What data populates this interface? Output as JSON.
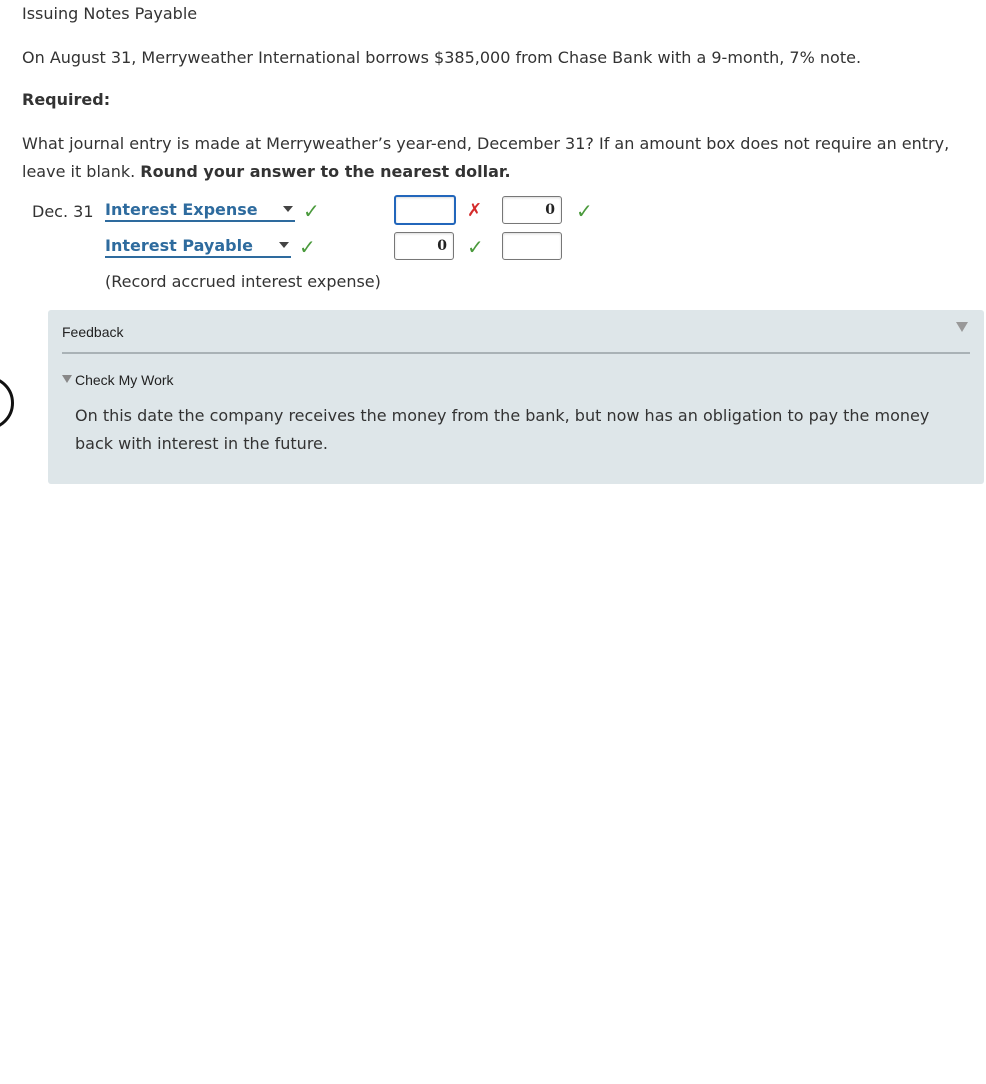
{
  "header": {
    "title": "Issuing Notes Payable"
  },
  "problem": {
    "intro": "On August 31, Merryweather International borrows $385,000 from Chase Bank with a 9-month, 7% note.",
    "required_label": "Required:",
    "question_text": "What journal entry is made at Merryweather’s year-end, December 31? If an amount box does not require an entry, leave it blank.",
    "question_bold": "Round your answer to the nearest dollar."
  },
  "journal": {
    "date": "Dec. 31",
    "rows": [
      {
        "account": "Interest Expense",
        "debit": "",
        "credit": "0",
        "account_status": "correct",
        "debit_status": "incorrect",
        "credit_status": "correct"
      },
      {
        "account": "Interest Payable",
        "debit": "0",
        "credit": "",
        "account_status": "correct",
        "debit_status": "correct"
      }
    ],
    "memo": "(Record accrued interest expense)"
  },
  "feedback": {
    "title": "Feedback",
    "check_my_work": "Check My Work",
    "text": "On this date the company receives the money from the bank, but now has an obligation to pay the money back with interest in the future."
  },
  "icons": {
    "correct": "check-icon",
    "incorrect": "x-icon",
    "correct_color": "#4a9a3c",
    "incorrect_color": "#d42b2b",
    "accent": "#2e6b9e"
  }
}
